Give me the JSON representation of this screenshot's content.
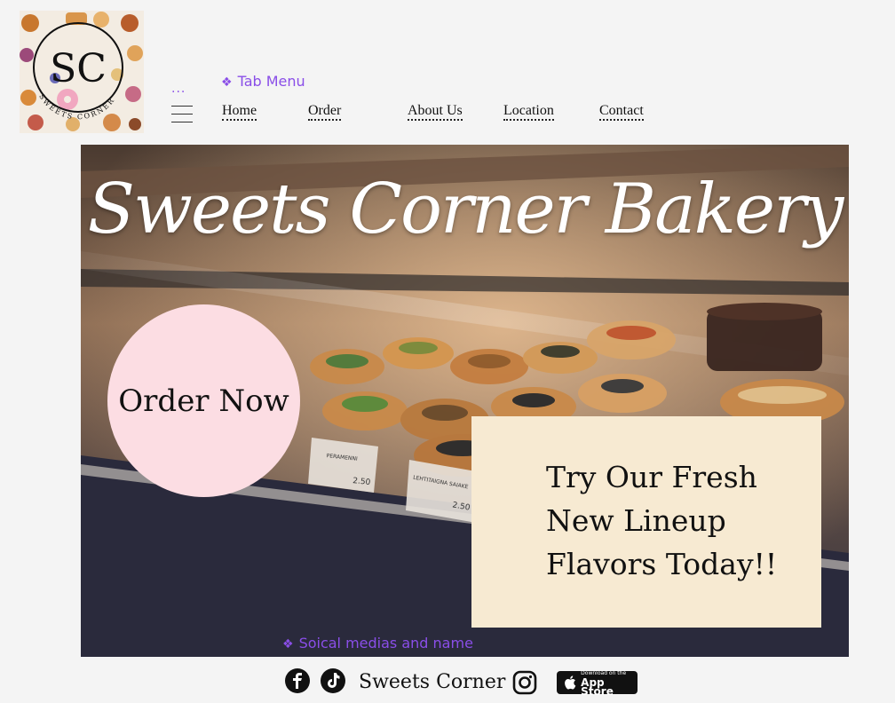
{
  "logo": {
    "monogram": "SC",
    "ring_text": "SWEETS CORNER"
  },
  "annotations": {
    "tab_menu": "Tab Menu",
    "social": "Soical medias and name"
  },
  "nav": {
    "more": "...",
    "items": [
      "Home",
      "Order",
      "About Us",
      "Location",
      "Contact"
    ]
  },
  "hero": {
    "title": "Sweets Corner Bakery",
    "order_button": "Order Now",
    "promo_lines": [
      "Try Our Fresh",
      "New Lineup",
      "Flavors Today!!"
    ],
    "price_tags": [
      {
        "name": "PERAMENNI",
        "price": "2.50"
      },
      {
        "name": "LEHTITAIGNA SAIAKE",
        "price": "2.50"
      }
    ]
  },
  "footer": {
    "brand_name": "Sweets Corner",
    "app_store_small": "Download on the",
    "app_store_big": "App Store"
  },
  "colors": {
    "annotation_purple": "#8a4ee8",
    "order_circle": "#fcdde3",
    "promo_box": "#f7ead2",
    "page_bg": "#f4f4f4"
  }
}
